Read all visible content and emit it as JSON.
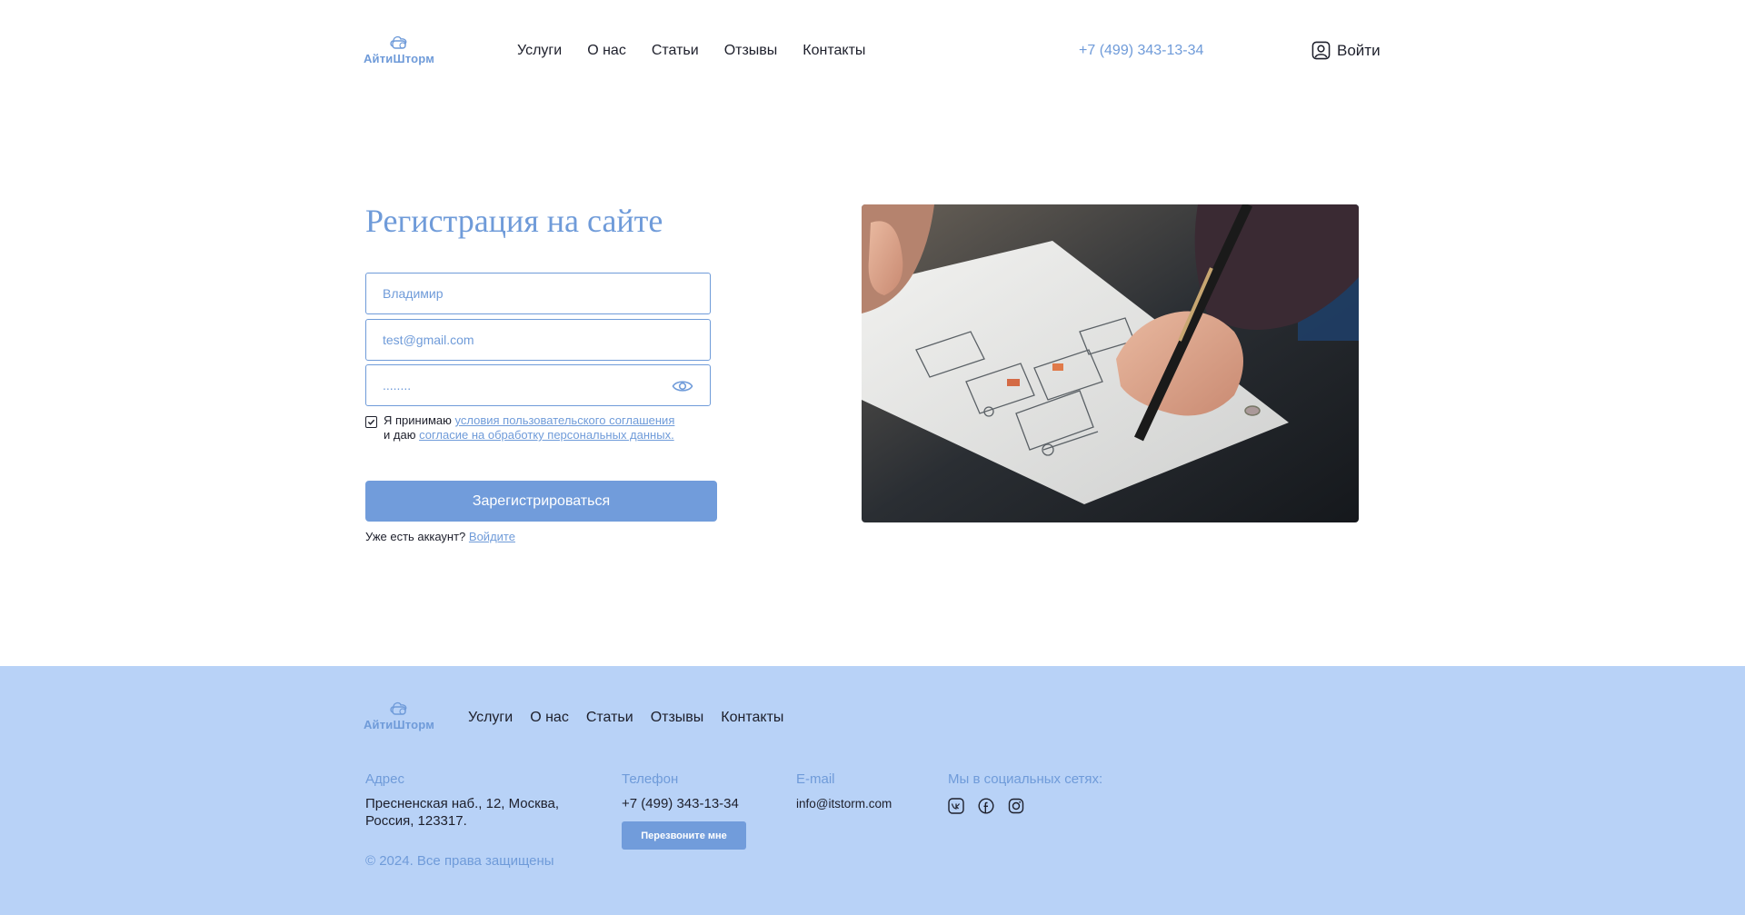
{
  "brand": {
    "name": "АйтиШторм"
  },
  "header": {
    "nav": [
      "Услуги",
      "О нас",
      "Статьи",
      "Отзывы",
      "Контакты"
    ],
    "phone": "+7 (499) 343-13-34",
    "login": "Войти"
  },
  "form": {
    "title": "Регистрация на сайте",
    "name_placeholder": "Владимир",
    "email_placeholder": "test@gmail.com",
    "password_value": "........",
    "agree_prefix": "Я принимаю",
    "agree_link1": "условия пользовательского соглашения",
    "agree_mid": "и даю",
    "agree_link2": "согласие на обработку персональных данных.",
    "submit": "Зарегистрироваться",
    "has_account": "Уже есть аккаунт?",
    "login_link": "Войдите"
  },
  "footer": {
    "nav": [
      "Услуги",
      "О нас",
      "Статьи",
      "Отзывы",
      "Контакты"
    ],
    "address_label": "Адрес",
    "address": "Пресненская наб., 12, Москва, Россия, 123317.",
    "phone_label": "Телефон",
    "phone": "+7 (499) 343-13-34",
    "callback": "Перезвоните мне",
    "email_label": "E-mail",
    "email": "info@itstorm.com",
    "social_label": "Мы в социальных сетях:",
    "socials": [
      "vk-icon",
      "facebook-icon",
      "instagram-icon"
    ],
    "copyright": "© 2024. Все права защищены"
  },
  "colors": {
    "accent": "#6f9bd9",
    "button": "#719cdb",
    "footer_bg": "#b8d2f7",
    "text": "#1d1f2b"
  }
}
